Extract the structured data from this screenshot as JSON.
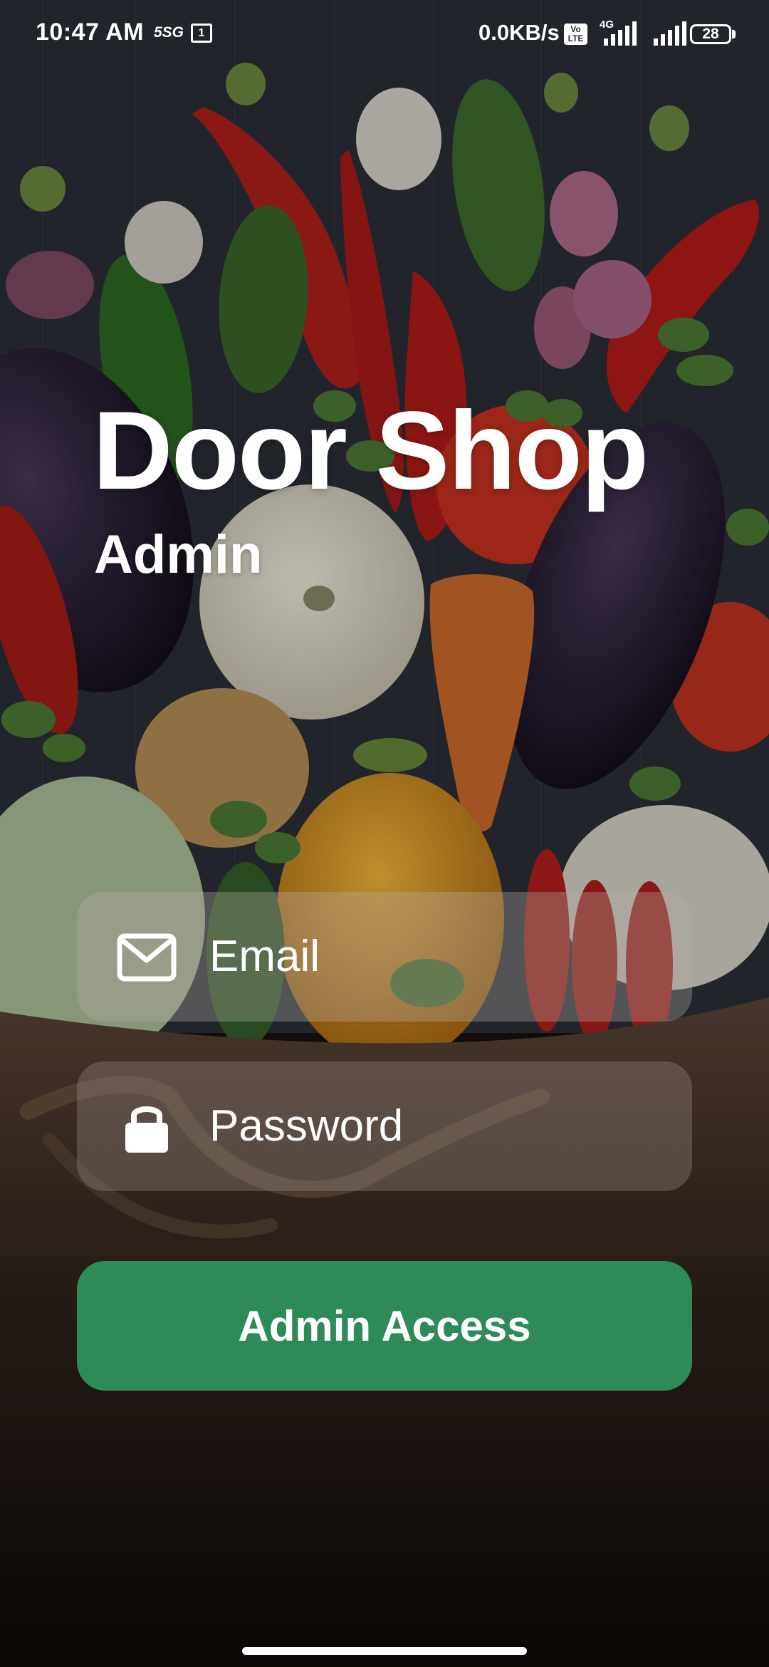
{
  "status_bar": {
    "time": "10:47 AM",
    "network_badge": "5SG",
    "sim_indicator": "1",
    "speed": "0.0KB/s",
    "volte_label": "Vo LTE",
    "network_type": "4G",
    "battery": "28"
  },
  "brand": {
    "title": "Door Shop",
    "subtitle": "Admin"
  },
  "form": {
    "email": {
      "placeholder": "Email",
      "value": "",
      "icon": "envelope-icon"
    },
    "password": {
      "placeholder": "Password",
      "value": "",
      "icon": "lock-icon"
    },
    "submit_label": "Admin Access"
  },
  "colors": {
    "accent": "#2e8b57",
    "field_background": "rgba(180,172,165,0.35)",
    "text": "#ffffff"
  }
}
